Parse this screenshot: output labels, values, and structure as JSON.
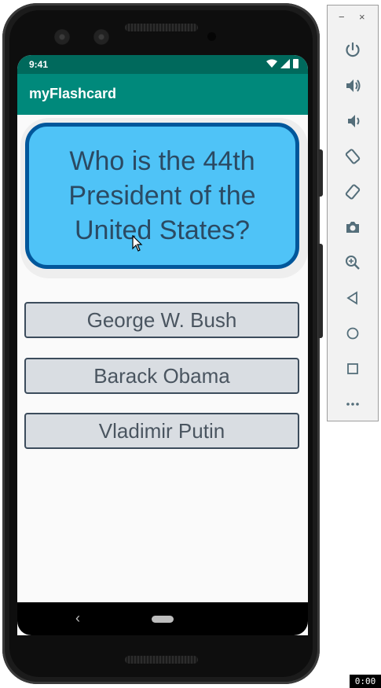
{
  "status_bar": {
    "time": "9:41"
  },
  "app_bar": {
    "title": "myFlashcard"
  },
  "flashcard": {
    "question": "Who is the 44th President of the United States?"
  },
  "answers": [
    "George W. Bush",
    "Barack Obama",
    "Vladimir Putin"
  ],
  "emulator_panel": {
    "window_controls": {
      "minimize": "−",
      "close": "×"
    },
    "controls": [
      "power-icon",
      "volume-up-icon",
      "volume-down-icon",
      "rotate-left-icon",
      "rotate-right-icon",
      "camera-icon",
      "zoom-icon",
      "back-icon",
      "home-icon",
      "overview-icon",
      "more-icon"
    ]
  },
  "recording_timer": "0:00",
  "colors": {
    "status_bar": "#00695c",
    "app_bar": "#00897b",
    "card_fill": "#4fc3f7",
    "card_border": "#01579b",
    "answer_fill": "#d9dde2"
  }
}
